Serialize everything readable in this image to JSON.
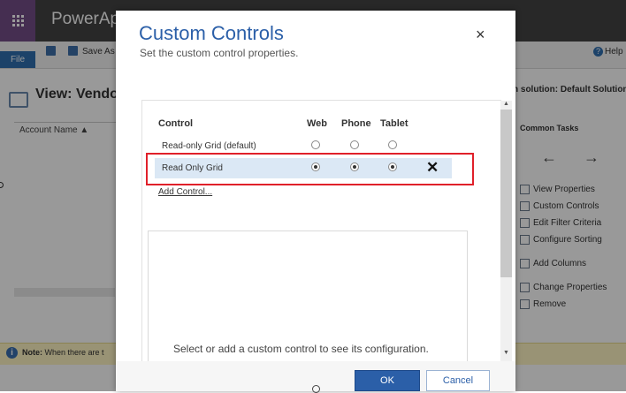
{
  "app": {
    "title": "PowerAp",
    "file_tab": "File",
    "save_as": "Save As",
    "help": "Help"
  },
  "view": {
    "title": "View: Vendor",
    "solution": "n solution: Default Solution",
    "column_header": "Account Name ▲"
  },
  "note": {
    "label": "Note:",
    "text": "When there are t"
  },
  "common_tasks": {
    "title": "Common Tasks",
    "items": [
      "View Properties",
      "Custom Controls",
      "Edit Filter Criteria",
      "Configure Sorting",
      "Add Columns",
      "Change Properties",
      "Remove"
    ]
  },
  "dialog": {
    "title": "Custom Controls",
    "subtitle": "Set the custom control properties.",
    "close_glyph": "×",
    "columns": {
      "control": "Control",
      "web": "Web",
      "phone": "Phone",
      "tablet": "Tablet"
    },
    "rows": [
      {
        "label": "Read-only Grid (default)",
        "web": false,
        "phone": false,
        "tablet": false
      },
      {
        "label": "Read Only Grid",
        "web": true,
        "phone": true,
        "tablet": true,
        "delete_glyph": "✕"
      }
    ],
    "add_control": "Add Control...",
    "config_hint": "Select or add a custom control to see its configuration.",
    "ok": "OK",
    "cancel": "Cancel"
  },
  "colors": {
    "accent": "#2b5fa8",
    "highlight_border": "#e0202a",
    "selected_row": "#dbe8f5",
    "waffle": "#744d87"
  },
  "icons": [
    "waffle-icon",
    "save-icon",
    "save-as-icon",
    "help-icon",
    "view-icon",
    "info-icon",
    "close-icon",
    "delete-icon",
    "arrow-left-icon",
    "arrow-right-icon"
  ]
}
